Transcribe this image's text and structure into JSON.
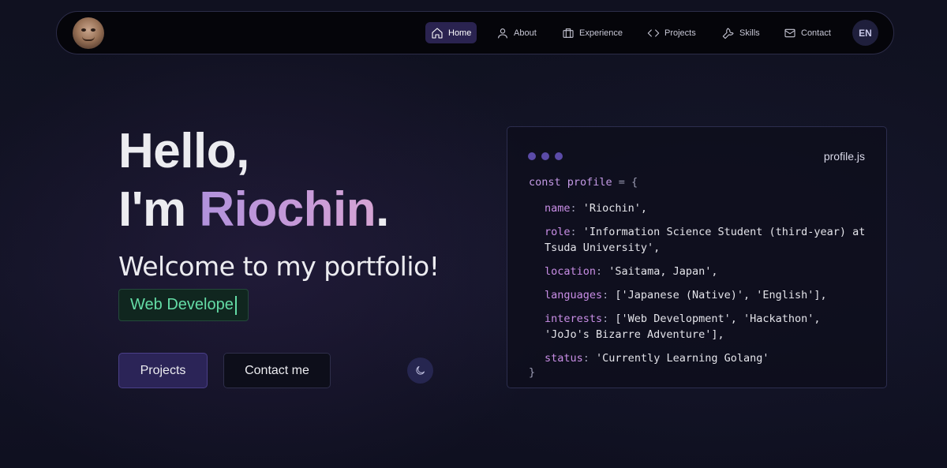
{
  "nav": {
    "items": [
      {
        "label": "Home",
        "icon": "home-icon",
        "active": true
      },
      {
        "label": "About",
        "icon": "user-icon",
        "active": false
      },
      {
        "label": "Experience",
        "icon": "briefcase-icon",
        "active": false
      },
      {
        "label": "Projects",
        "icon": "code-icon",
        "active": false
      },
      {
        "label": "Skills",
        "icon": "wrench-icon",
        "active": false
      },
      {
        "label": "Contact",
        "icon": "mail-icon",
        "active": false
      }
    ],
    "lang": "EN"
  },
  "hero": {
    "hello": "Hello,",
    "im": "I'm ",
    "name": "Riochin",
    "period": ".",
    "welcome": "Welcome to my portfolio!",
    "typing": "Web Develope",
    "primary_button": "Projects",
    "secondary_button": "Contact me"
  },
  "code_card": {
    "filename": "profile.js",
    "open": {
      "kw": "const",
      "ident": " profile",
      "rest": " = {"
    },
    "close": "}",
    "fields": [
      {
        "key": "name",
        "value": "'Riochin',"
      },
      {
        "key": "role",
        "value": "'Information Science Student (third-year) at",
        "value2": "Tsuda University',"
      },
      {
        "key": "location",
        "value": "'Saitama, Japan',"
      },
      {
        "key": "languages",
        "value": "['Japanese (Native)', 'English'],"
      },
      {
        "key": "interests",
        "value": "['Web Development', 'Hackathon',",
        "value2": "'JoJo's Bizarre Adventure'],"
      },
      {
        "key": "status",
        "value": "'Currently Learning Golang'"
      }
    ]
  },
  "colors": {
    "accent": "#2b2457",
    "name_gradient_start": "#b192dc",
    "typing_text": "#64dca6",
    "code_key": "#c98ee6"
  }
}
